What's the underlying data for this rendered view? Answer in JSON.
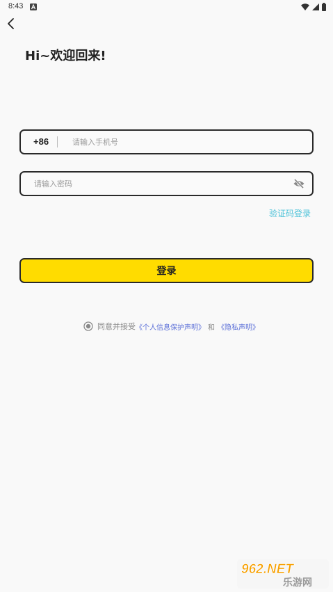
{
  "status_bar": {
    "time": "8:43",
    "icons": [
      "notification-a-icon",
      "wifi-icon",
      "cellular-signal-icon",
      "battery-icon"
    ]
  },
  "header": {
    "back_icon": "chevron-left-icon",
    "title": "Hi~欢迎回来!"
  },
  "phone_field": {
    "country_code": "+86",
    "placeholder": "请输入手机号",
    "value": ""
  },
  "password_field": {
    "placeholder": "请输入密码",
    "value": "",
    "visibility_icon": "eye-off-icon"
  },
  "sms_login_label": "验证码登录",
  "login_button_label": "登录",
  "agreement": {
    "checked": true,
    "prefix": "同意并接受",
    "link_personal_info": "《个人信息保护声明》",
    "and": "和",
    "link_privacy": "《隐私声明》"
  },
  "watermark": {
    "brand_top": "962.NET",
    "brand_bottom": "乐游网"
  },
  "colors": {
    "background": "#f9f9f9",
    "accent_yellow": "#ffdc00",
    "border_dark": "#2a2a2a",
    "link_cyan": "#4fc3d9",
    "link_blue": "#5b6fd8",
    "placeholder_gray": "#9a9a9a"
  }
}
